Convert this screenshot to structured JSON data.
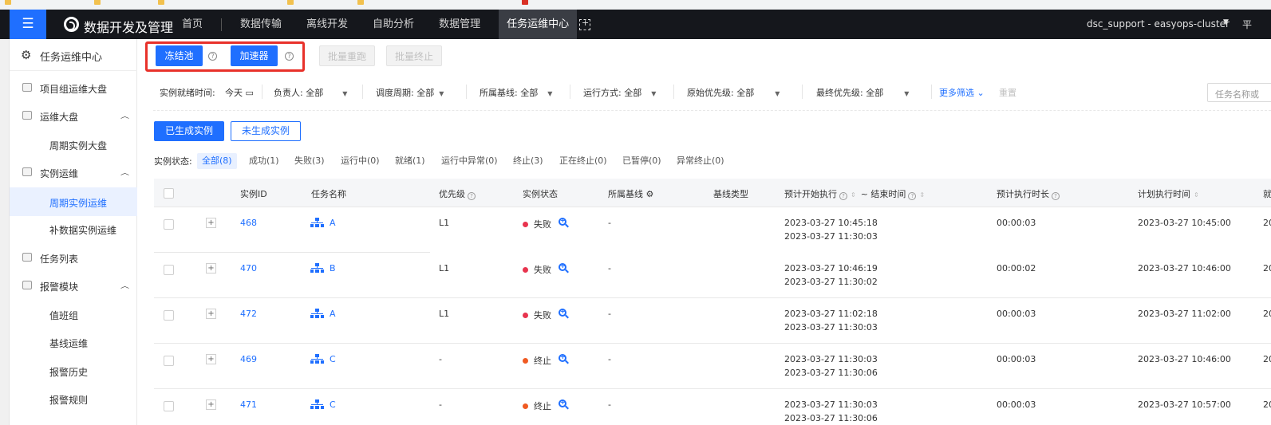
{
  "app": {
    "brand": "数据开发及管理",
    "nav": [
      "首页",
      "数据传输",
      "离线开发",
      "自助分析",
      "数据管理",
      "任务运维中心"
    ],
    "active_nav": "任务运维中心",
    "user": "dsc_support - easyops-cluster",
    "right_cut": "平"
  },
  "sidebar": {
    "title": "任务运维中心",
    "items": [
      {
        "label": "项目组运维大盘",
        "level": 1,
        "icon": "dashboard-icon"
      },
      {
        "label": "运维大盘",
        "level": 1,
        "icon": "monitor-icon",
        "expanded": true
      },
      {
        "label": "周期实例大盘",
        "level": 2
      },
      {
        "label": "实例运维",
        "level": 1,
        "icon": "instance-icon",
        "expanded": true
      },
      {
        "label": "周期实例运维",
        "level": 2,
        "active": true
      },
      {
        "label": "补数据实例运维",
        "level": 2
      },
      {
        "label": "任务列表",
        "level": 1,
        "icon": "list-icon"
      },
      {
        "label": "报警模块",
        "level": 1,
        "icon": "alarm-icon",
        "expanded": true
      },
      {
        "label": "值班组",
        "level": 2
      },
      {
        "label": "基线运维",
        "level": 2
      },
      {
        "label": "报警历史",
        "level": 2
      },
      {
        "label": "报警规则",
        "level": 2
      }
    ]
  },
  "toolbar": {
    "freeze_pool": "冻结池",
    "accelerator": "加速器",
    "batch_rerun": "批量重跑",
    "batch_stop": "批量终止"
  },
  "filters": {
    "ready_time_label": "实例就绪时间:",
    "ready_time_value": "今天",
    "owner": "负责人: 全部",
    "cycle": "调度周期: 全部",
    "baseline": "所属基线: 全部",
    "run_mode": "运行方式: 全部",
    "orig_priority": "原始优先级: 全部",
    "final_priority": "最终优先级: 全部",
    "more": "更多筛选",
    "reset": "重置",
    "search_placeholder": "任务名称或"
  },
  "tabs": {
    "generated": "已生成实例",
    "not_generated": "未生成实例"
  },
  "status_filter": {
    "label": "实例状态:",
    "chips": [
      "全部(8)",
      "成功(1)",
      "失败(3)",
      "运行中(0)",
      "就绪(1)",
      "运行中异常(0)",
      "终止(3)",
      "正在终止(0)",
      "已暂停(0)",
      "异常终止(0)"
    ]
  },
  "table": {
    "headers": {
      "id": "实例ID",
      "name": "任务名称",
      "priority": "优先级",
      "state": "实例状态",
      "baseline": "所属基线",
      "baseline_type": "基线类型",
      "expected_start": "预计开始执行",
      "end_time": "~ 结束时间",
      "expected_duration": "预计执行时长",
      "plan_time": "计划执行时间",
      "cut": "就"
    },
    "rows": [
      {
        "id": "468",
        "name": "A",
        "priority": "L1",
        "state": "失败",
        "state_color": "#e8344e",
        "baseline": "-",
        "start": "2023-03-27 10:45:18",
        "end": "2023-03-27 11:30:03",
        "duration": "00:00:03",
        "plan": "2023-03-27 10:45:00",
        "cut": "20"
      },
      {
        "id": "470",
        "name": "B",
        "priority": "L1",
        "state": "失败",
        "state_color": "#e8344e",
        "baseline": "-",
        "start": "2023-03-27 10:46:19",
        "end": "2023-03-27 11:30:02",
        "duration": "00:00:02",
        "plan": "2023-03-27 10:46:00",
        "cut": "20"
      },
      {
        "id": "472",
        "name": "A",
        "priority": "L1",
        "state": "失败",
        "state_color": "#e8344e",
        "baseline": "-",
        "start": "2023-03-27 11:02:18",
        "end": "2023-03-27 11:30:03",
        "duration": "00:00:03",
        "plan": "2023-03-27 11:02:00",
        "cut": "20"
      },
      {
        "id": "469",
        "name": "C",
        "priority": "-",
        "state": "终止",
        "state_color": "#f05a22",
        "baseline": "-",
        "start": "2023-03-27 11:30:03",
        "end": "2023-03-27 11:30:06",
        "duration": "00:00:03",
        "plan": "2023-03-27 10:46:00",
        "cut": "20"
      },
      {
        "id": "471",
        "name": "C",
        "priority": "-",
        "state": "终止",
        "state_color": "#f05a22",
        "baseline": "-",
        "start": "2023-03-27 11:30:03",
        "end": "2023-03-27 11:30:06",
        "duration": "00:00:03",
        "plan": "2023-03-27 10:57:00",
        "cut": "20"
      }
    ]
  },
  "colors": {
    "accent": "#1f6fff",
    "topbar": "#15171c",
    "highlight": "#e8312a",
    "fail": "#e8344e",
    "stop": "#f05a22"
  }
}
